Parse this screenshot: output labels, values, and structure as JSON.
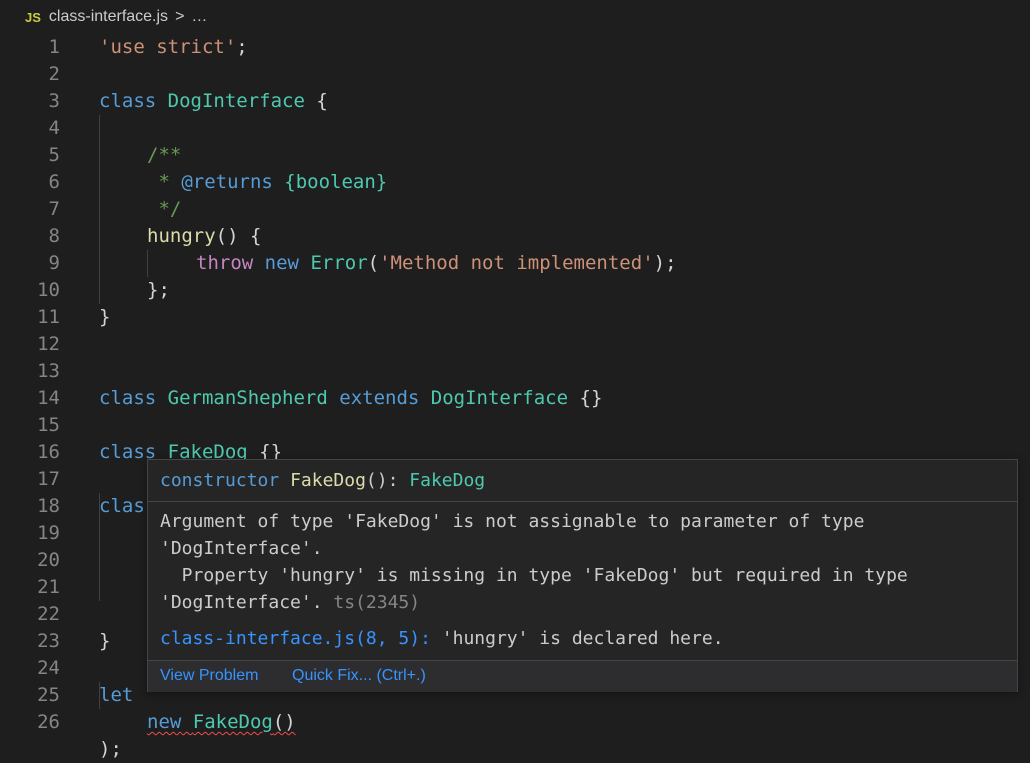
{
  "breadcrumb": {
    "lang_badge": "JS",
    "file": "class-interface.js",
    "separator": ">",
    "more": "…"
  },
  "line_numbers": [
    "1",
    "2",
    "3",
    "4",
    "5",
    "6",
    "7",
    "8",
    "9",
    "10",
    "11",
    "12",
    "13",
    "14",
    "15",
    "16",
    "17",
    "18",
    "19",
    "20",
    "21",
    "22",
    "23",
    "24",
    "25",
    "26"
  ],
  "code": {
    "l1": {
      "str": "'use strict'",
      "semi": ";"
    },
    "l3": {
      "kw": "class",
      "name": "DogInterface",
      "brace": "{"
    },
    "l5": {
      "cmt": "/**"
    },
    "l6": {
      "star": " * ",
      "tag": "@returns",
      "type": "{boolean}"
    },
    "l7": {
      "cmt": " */"
    },
    "l8": {
      "fn": "hungry",
      "rest": "() {"
    },
    "l9": {
      "throw": "throw",
      "new": "new",
      "cls": "Error",
      "open": "(",
      "str": "'Method not implemented'",
      "close": ");"
    },
    "l10": {
      "text": "};"
    },
    "l11": {
      "text": "}"
    },
    "l13": {
      "kw": "class",
      "name": "GermanShepherd",
      "extends": "extends",
      "base": "DogInterface",
      "brace": "{}"
    },
    "l15": {
      "kw": "class",
      "name": "FakeDog",
      "brace": "{}"
    },
    "l17": {
      "kw": "clas"
    },
    "l22": {
      "text": "}"
    },
    "l24": {
      "kw": "let"
    },
    "l25": {
      "new": "new",
      "cls": "FakeDog",
      "rest": "()"
    },
    "l26": {
      "text": ");"
    }
  },
  "hover": {
    "sig_kw": "constructor",
    "sig_name": "FakeDog",
    "sig_mid": "(): ",
    "sig_type": "FakeDog",
    "message_l1": "Argument of type 'FakeDog' is not assignable to parameter of type",
    "message_l2": "'DogInterface'.",
    "message_l3": "  Property 'hungry' is missing in type 'FakeDog' but required in type",
    "message_l4": "'DogInterface'.",
    "error_code": " ts(2345)",
    "related_link": "class-interface.js(8, 5):",
    "related_text": " 'hungry' is declared here.",
    "view_problem": "View Problem",
    "quick_fix": "Quick Fix... (Ctrl+.)"
  },
  "colors": {
    "keyword": "#569cd6",
    "string": "#ce9178",
    "class": "#4ec9b0",
    "function": "#dcdcaa",
    "comment": "#6a9955",
    "control": "#c586c0",
    "link": "#3794ff"
  }
}
